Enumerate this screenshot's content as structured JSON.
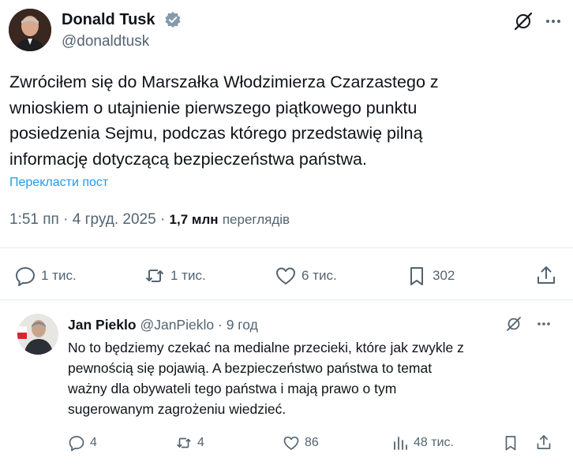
{
  "tweet": {
    "author_name": "Donald Tusk",
    "author_handle": "@donaldtusk",
    "text_lines": [
      "Zwróciłem się do Marszałka Włodzimierza Czarzastego z",
      "wnioskiem o utajnienie pierwszego piątkowego punktu",
      "posiedzenia Sejmu, podczas którego przedstawię pilną",
      "informację dotyczącą bezpieczeństwa państwa."
    ],
    "translate_label": "Перекласти пост",
    "time": "1:51 пп",
    "date": "4 груд. 2025",
    "views_count": "1,7 млн",
    "views_label": "переглядів",
    "actions": {
      "replies": "1 тис.",
      "reposts": "1 тис.",
      "likes": "6 тис.",
      "bookmarks": "302"
    }
  },
  "reply": {
    "author_name": "Jan Pieklo",
    "author_handle": "@JanPieklo",
    "time": "9 год",
    "text_lines": [
      "No to będziemy czekać na medialne przecieki, które jak zwykle z",
      "pewnością się pojawią. A bezpieczeństwo państwa to temat",
      "ważny dla obywateli tego państwa i mają prawo o tym",
      "sugerowanym zagrożeniu wiedzieć."
    ],
    "actions": {
      "replies": "4",
      "reposts": "4",
      "likes": "86",
      "views": "48 тис."
    }
  },
  "colors": {
    "text": "#0f1419",
    "secondary": "#536471",
    "link": "#1d9bf0",
    "verified": "#829aab",
    "divider": "#e6ecf0"
  }
}
